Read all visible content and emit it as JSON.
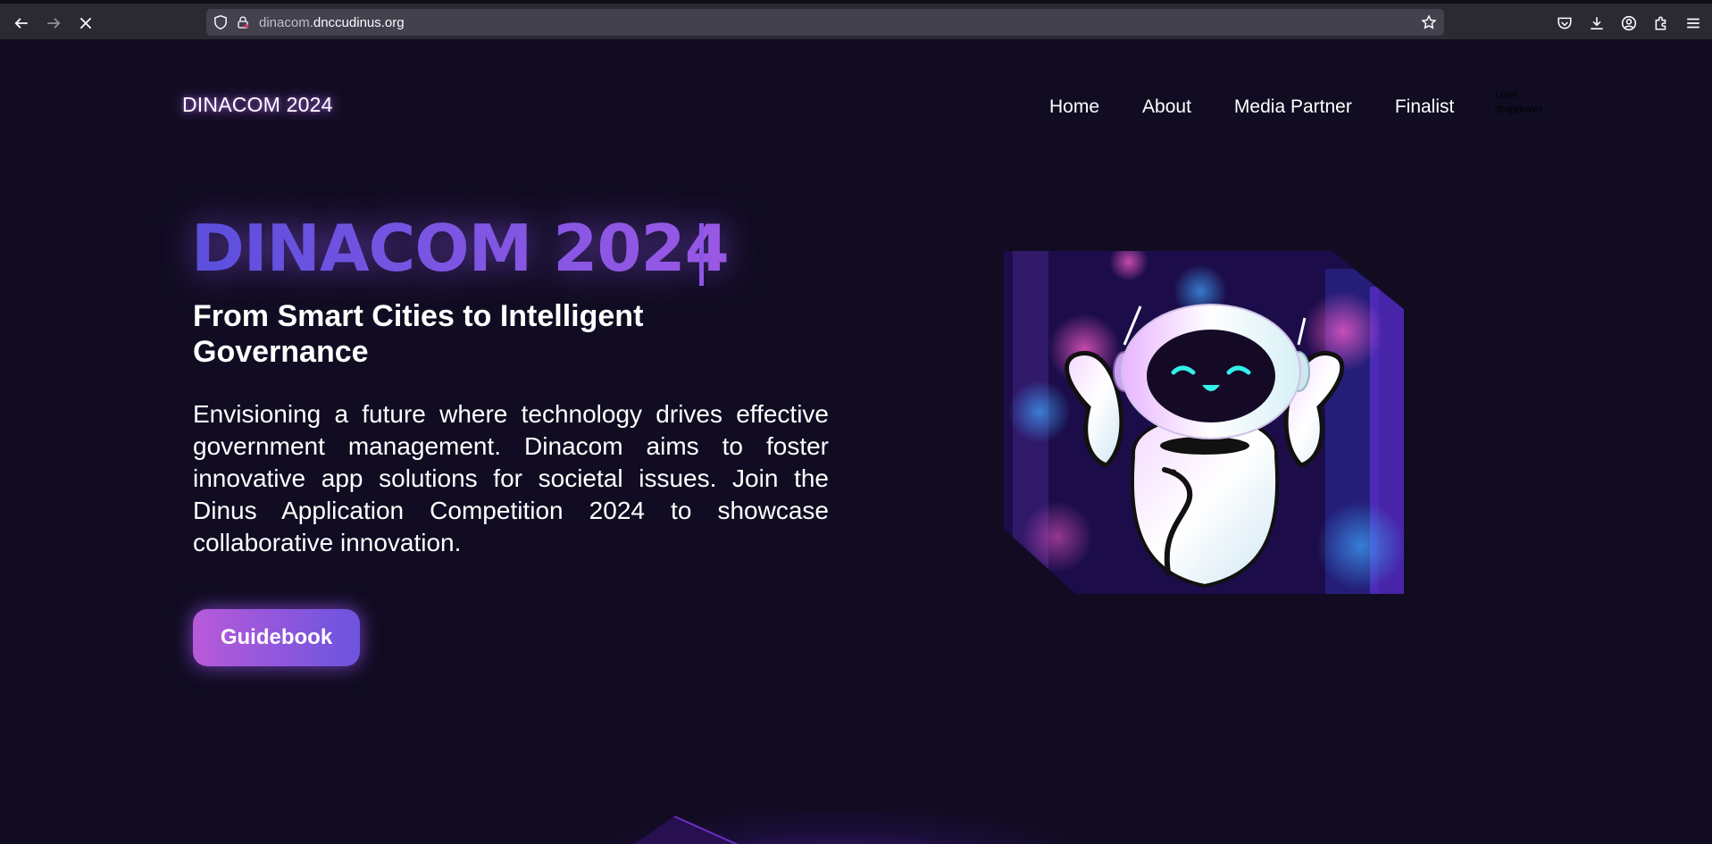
{
  "browser": {
    "url_prefix": "dinacom.",
    "url_domain": "dnccudinus.org"
  },
  "header": {
    "brand": "DINACOM 2024",
    "nav": [
      "Home",
      "About",
      "Media Partner",
      "Finalist"
    ],
    "user_dropdown": "User dropdown"
  },
  "hero": {
    "title": "DINACOM 2024",
    "subtitle": "From Smart Cities to Intelligent Governance",
    "description": "Envisioning a future where technology drives effective government management. Dinacom aims to foster innovative app solutions for societal issues. Join the Dinus Application Competition 2024 to showcase collaborative innovation.",
    "button": "Guidebook"
  },
  "colors": {
    "background": "#110c22",
    "accent_blue": "#5a4fdc",
    "accent_purple": "#b85ad9"
  }
}
